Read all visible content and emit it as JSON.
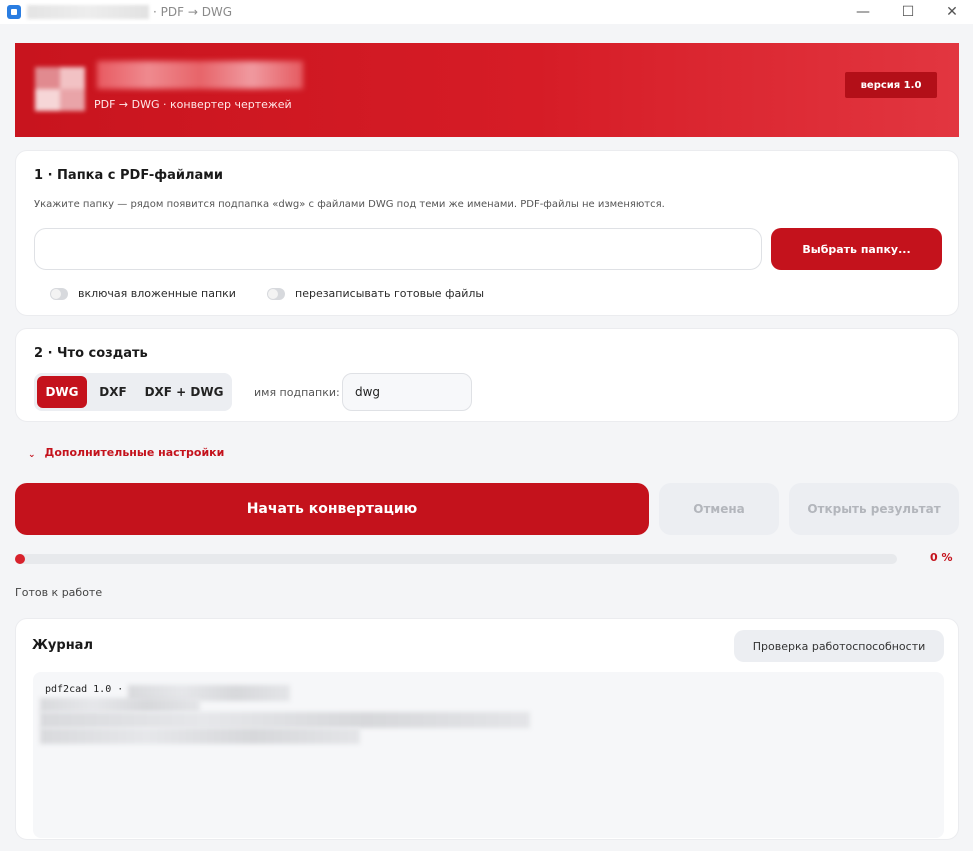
{
  "window": {
    "title": "· PDF → DWG",
    "controls": {
      "minimize": "—",
      "maximize": "☐",
      "close": "✕"
    }
  },
  "header": {
    "subtitle": "PDF → DWG · конвертер чертежей",
    "version": "версия 1.0"
  },
  "step1": {
    "title": "1 · Папка с PDF-файлами",
    "hint": "Укажите папку — рядом появится подпапка «dwg» с файлами DWG под теми же именами. PDF-файлы не изменяются.",
    "folder_value": "",
    "pick_button": "Выбрать папку...",
    "toggles": [
      {
        "label": "включая вложенные папки",
        "on": false
      },
      {
        "label": "перезаписывать готовые файлы",
        "on": false
      }
    ]
  },
  "step2": {
    "title": "2 · Что создать",
    "formats": [
      {
        "label": "DWG",
        "selected": true
      },
      {
        "label": "DXF",
        "selected": false
      },
      {
        "label": "DXF + DWG",
        "selected": false
      }
    ],
    "subfolder_label": "имя подпапки:",
    "subfolder_value": "dwg"
  },
  "advanced": {
    "label": "Дополнительные настройки",
    "icon": "chevron-down-icon"
  },
  "actions": {
    "start": "Начать конвертацию",
    "cancel": "Отмена",
    "open_result": "Открыть результат"
  },
  "progress": {
    "percent": 0,
    "label": "0 %",
    "status": "Готов к работе"
  },
  "journal": {
    "title": "Журнал",
    "health_button": "Проверка работоспособности",
    "first_line": "pdf2cad 1.0 ·"
  },
  "colors": {
    "accent": "#c4121c",
    "header_start": "#c8141e",
    "header_end": "#e23640",
    "background": "#f4f5f7",
    "disabled_text": "#b3b6bc"
  }
}
